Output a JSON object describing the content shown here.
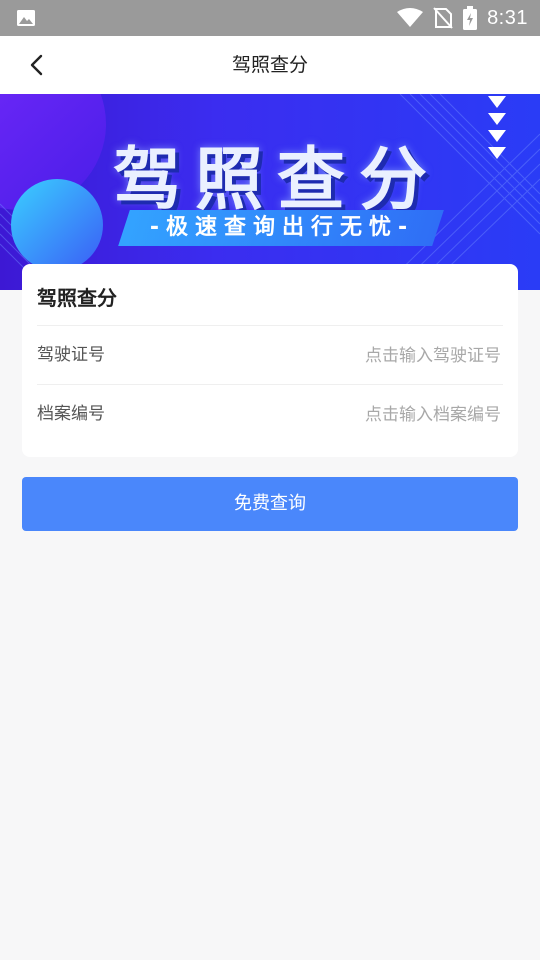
{
  "status_bar": {
    "time": "8:31",
    "icons": [
      "gallery-icon",
      "wifi-icon",
      "no-sim-icon",
      "battery-icon"
    ]
  },
  "header": {
    "title": "驾照查分",
    "back_icon": "chevron-left-icon"
  },
  "banner": {
    "title": "驾照查分",
    "subtitle": "-极速查询出行无忧-"
  },
  "form": {
    "title": "驾照查分",
    "fields": [
      {
        "label": "驾驶证号",
        "placeholder": "点击输入驾驶证号",
        "value": ""
      },
      {
        "label": "档案编号",
        "placeholder": "点击输入档案编号",
        "value": ""
      }
    ]
  },
  "actions": {
    "submit_label": "免费查询"
  },
  "colors": {
    "primary": "#4a87fb",
    "banner_start": "#3d18d4",
    "banner_end": "#2a3cf6",
    "status_bar": "#9a9a9a"
  }
}
